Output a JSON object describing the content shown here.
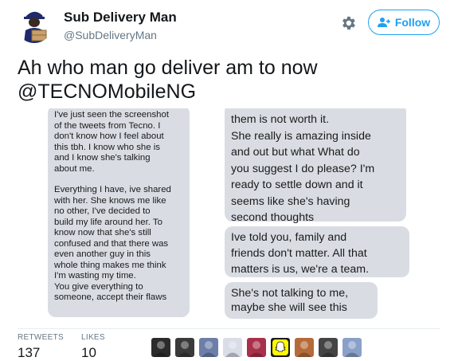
{
  "user": {
    "display_name": "Sub Delivery Man",
    "screen_name": "@SubDeliveryMan"
  },
  "actions": {
    "follow_label": "Follow"
  },
  "tweet": {
    "line1": "Ah who man go deliver am to now",
    "line2": "@TECNOMobileNG"
  },
  "screenshot": {
    "left_bubble": [
      "I've just seen the screenshot",
      "of the tweets from Tecno. I",
      "don't know how I feel about",
      "this tbh. I know who she is",
      "and I know she's talking",
      "about me.",
      "",
      "Everything I have, ive shared",
      "with her. She knows me like",
      "no other, I've decided to",
      "build my life around her. To",
      "know now that she's still",
      "confused and that there was",
      "even another guy in this",
      "whole thing makes me think",
      "I'm wasting my time.",
      "You give everything to",
      "someone, accept their flaws"
    ],
    "right_bubble_1": [
      "them is not worth it.",
      "She really is amazing inside",
      "and out but what  What do",
      "you suggest I do please? I'm",
      "ready to settle down and it",
      "seems like she's having",
      "second thoughts"
    ],
    "right_bubble_2": [
      "Ive told you, family and",
      "friends don't matter. All that",
      "matters is us, we're a team."
    ],
    "right_bubble_3": [
      "She's not talking to me,",
      "maybe she will see this"
    ]
  },
  "stats": {
    "retweets_label": "RETWEETS",
    "retweets_count": "137",
    "likes_label": "LIKES",
    "likes_count": "10"
  },
  "likers": [
    {
      "icon": "liker-avatar",
      "color": "#2b2b2b"
    },
    {
      "icon": "liker-avatar",
      "color": "#3a3a3a"
    },
    {
      "icon": "liker-avatar",
      "color": "#6c7fa8"
    },
    {
      "icon": "liker-avatar",
      "color": "#d8dde6"
    },
    {
      "icon": "liker-avatar",
      "color": "#a8304a"
    },
    {
      "icon": "snapchat-avatar",
      "color": "#fffc00"
    },
    {
      "icon": "liker-avatar",
      "color": "#b56a3a"
    },
    {
      "icon": "liker-avatar",
      "color": "#444444"
    },
    {
      "icon": "liker-avatar",
      "color": "#8aa0c8"
    }
  ],
  "colors": {
    "accent": "#1da1f2",
    "text": "#14171a",
    "muted": "#657786",
    "bubble": "#d9dde3"
  }
}
